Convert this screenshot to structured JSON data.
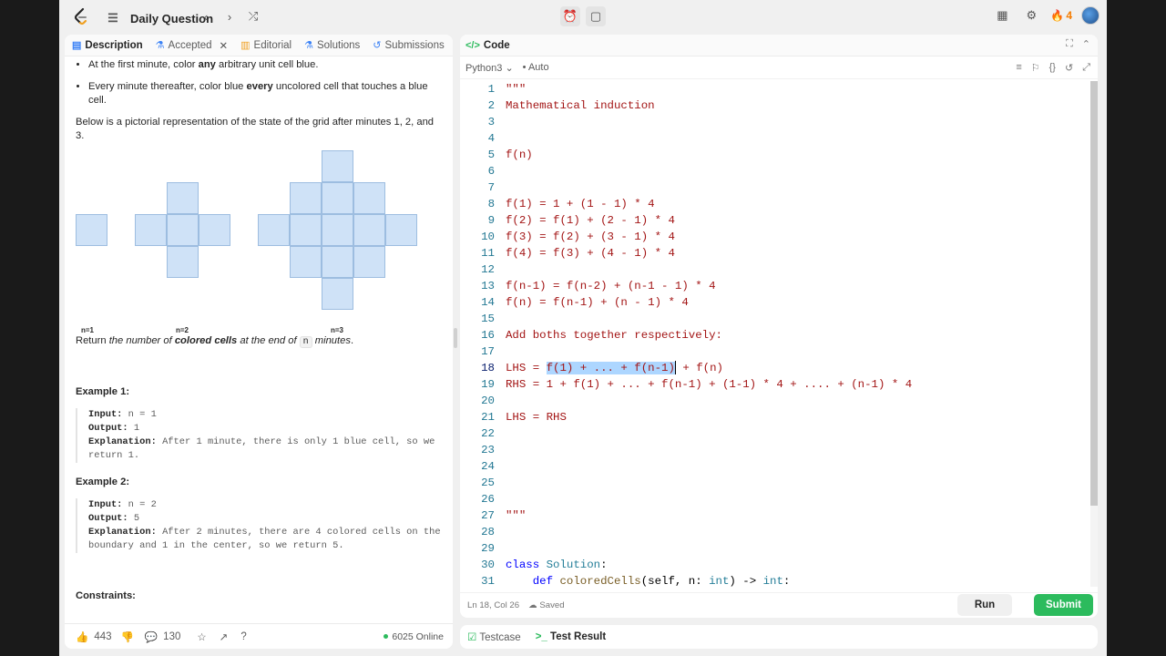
{
  "topbar": {
    "title": "Daily Question",
    "streak_count": "4"
  },
  "left_tabs": {
    "description": "Description",
    "accepted": "Accepted",
    "editorial": "Editorial",
    "solutions": "Solutions",
    "submissions": "Submissions"
  },
  "description": {
    "bullet1_pre": "At the first minute, color ",
    "bullet1_bold": "any",
    "bullet1_post": " arbitrary unit cell blue.",
    "bullet2_pre": "Every minute thereafter, color blue ",
    "bullet2_bold": "every",
    "bullet2_post": " uncolored cell that touches a blue cell.",
    "pictorial": "Below is a pictorial representation of the state of the grid after minutes 1, 2, and 3.",
    "n_labels": [
      "n=1",
      "n=2",
      "n=3"
    ],
    "return_pre": "Return ",
    "return_it1": "the number of ",
    "return_bold": "colored cells",
    "return_it2": " at the end of ",
    "return_code": "n",
    "return_it3": " minutes",
    "return_end": "."
  },
  "examples": [
    {
      "title": "Example 1:",
      "input_label": "Input:",
      "input": " n = 1",
      "output_label": "Output:",
      "output": " 1",
      "expl_label": "Explanation:",
      "expl": " After 1 minute, there is only 1 blue cell, so we return 1."
    },
    {
      "title": "Example 2:",
      "input_label": "Input:",
      "input": " n = 2",
      "output_label": "Output:",
      "output": " 5",
      "expl_label": "Explanation:",
      "expl": " After 2 minutes, there are 4 colored cells on the boundary and 1 in the center, so we return 5."
    }
  ],
  "constraints_title": "Constraints:",
  "bottom": {
    "likes": "443",
    "comments": "130",
    "online": "6025 Online"
  },
  "code_panel": {
    "title": "Code",
    "language": "Python3",
    "mode": "Auto",
    "status": "Ln 18, Col 26",
    "saved": "Saved",
    "run": "Run",
    "submit": "Submit"
  },
  "code_lines": [
    "\"\"\"",
    "Mathematical induction",
    "",
    "",
    "f(n)",
    "",
    "",
    "f(1) = 1 + (1 - 1) * 4",
    "f(2) = f(1) + (2 - 1) * 4",
    "f(3) = f(2) + (3 - 1) * 4",
    "f(4) = f(3) + (4 - 1) * 4",
    "",
    "f(n-1) = f(n-2) + (n-1 - 1) * 4",
    "f(n) = f(n-1) + (n - 1) * 4",
    "",
    "Add boths together respectively:",
    "",
    "LHS = f(1) + ... + f(n-1) + f(n)",
    "RHS = 1 + f(1) + ... + f(n-1) + (1-1) * 4 + .... + (n-1) * 4",
    "",
    "LHS = RHS",
    "",
    "",
    "",
    "",
    "",
    "\"\"\"",
    "",
    "",
    "class Solution:",
    "    def coloredCells(self, n: int) -> int:"
  ],
  "selection": {
    "line": 18,
    "before": "LHS = ",
    "selected": "f(1) + ... + f(n-1)",
    "after": " + f(n)"
  },
  "bottom_tabs": {
    "testcase": "Testcase",
    "test_result": "Test Result"
  }
}
